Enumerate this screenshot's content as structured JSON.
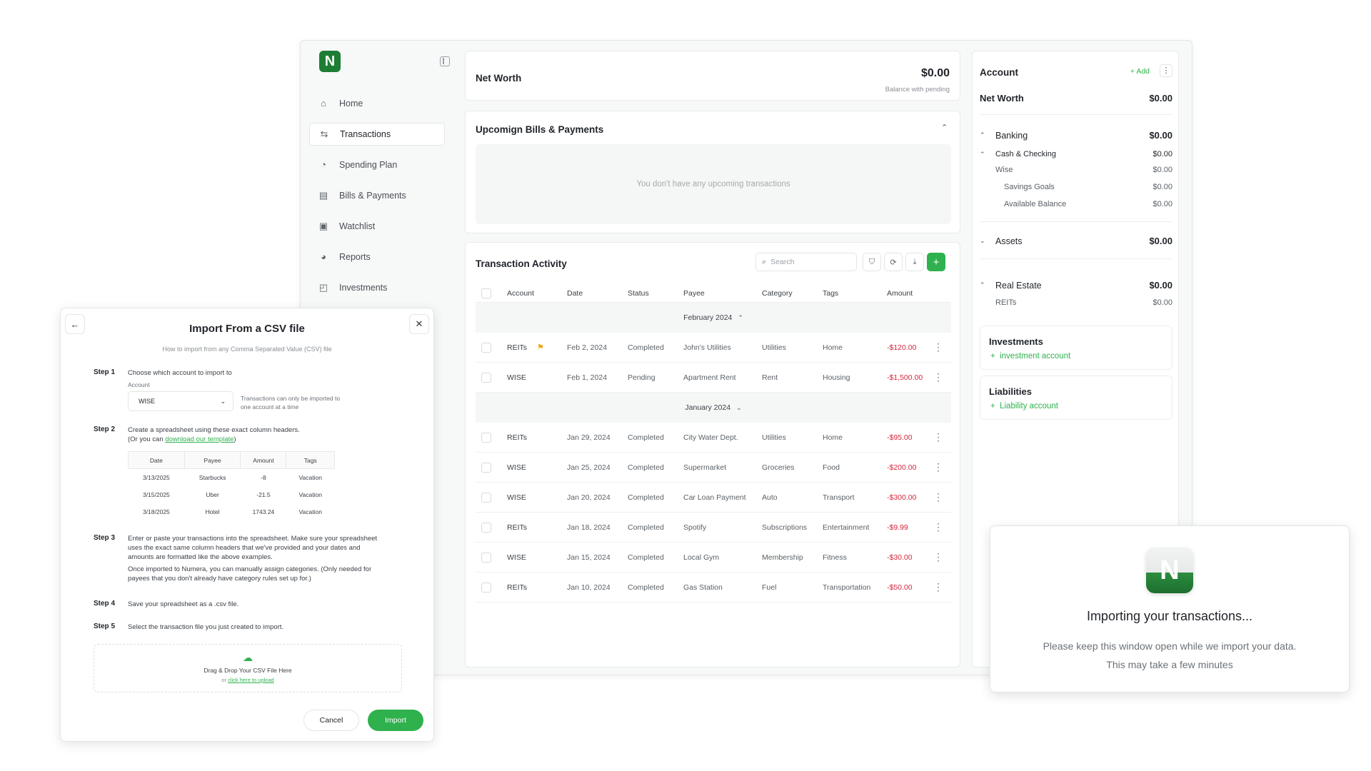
{
  "app": {
    "logo_letter": "N"
  },
  "sidebar": {
    "items": [
      {
        "label": "Home",
        "icon": "home-icon"
      },
      {
        "label": "Transactions",
        "icon": "transfer-icon",
        "active": true
      },
      {
        "label": "Spending Plan",
        "icon": "plan-icon"
      },
      {
        "label": "Bills & Payments",
        "icon": "bill-icon"
      },
      {
        "label": "Watchlist",
        "icon": "watchlist-icon"
      },
      {
        "label": "Reports",
        "icon": "pie-chart-icon"
      },
      {
        "label": "Investments",
        "icon": "investments-icon"
      }
    ]
  },
  "networth": {
    "label": "Net Worth",
    "value": "$0.00",
    "sub": "Balance with pending"
  },
  "bills": {
    "title": "Upcomign Bills & Payments",
    "empty": "You don't have any upcoming transactions"
  },
  "activity": {
    "title": "Transaction Activity",
    "search_placeholder": "Search",
    "columns": [
      "Account",
      "Date",
      "Status",
      "Payee",
      "Category",
      "Tags",
      "Amount"
    ],
    "groups": [
      {
        "label": "February 2024",
        "rows": [
          {
            "account": "REITs",
            "flag": true,
            "date": "Feb 2, 2024",
            "status": "Completed",
            "payee": "John's Utilities",
            "category": "Utilities",
            "tags": "Home",
            "amount": "-$120.00"
          },
          {
            "account": "WISE",
            "flag": false,
            "date": "Feb 1, 2024",
            "status": "Pending",
            "payee": "Apartment Rent",
            "category": "Rent",
            "tags": "Housing",
            "amount": "-$1,500.00"
          }
        ]
      },
      {
        "label": "January 2024",
        "rows": [
          {
            "account": "REITs",
            "date": "Jan 29, 2024",
            "status": "Completed",
            "payee": "City Water Dept.",
            "category": "Utilities",
            "tags": "Home",
            "amount": "-$95.00"
          },
          {
            "account": "WISE",
            "date": "Jan 25, 2024",
            "status": "Completed",
            "payee": "Supermarket",
            "category": "Groceries",
            "tags": "Food",
            "amount": "-$200.00"
          },
          {
            "account": "WISE",
            "date": "Jan 20, 2024",
            "status": "Completed",
            "payee": "Car Loan Payment",
            "category": "Auto",
            "tags": "Transport",
            "amount": "-$300.00"
          },
          {
            "account": "REITs",
            "date": "Jan 18, 2024",
            "status": "Completed",
            "payee": "Spotify",
            "category": "Subscriptions",
            "tags": "Entertainment",
            "amount": "-$9.99"
          },
          {
            "account": "WISE",
            "date": "Jan 15, 2024",
            "status": "Completed",
            "payee": "Local Gym",
            "category": "Membership",
            "tags": "Fitness",
            "amount": "-$30.00"
          },
          {
            "account": "REITs",
            "date": "Jan 10, 2024",
            "status": "Completed",
            "payee": "Gas Station",
            "category": "Fuel",
            "tags": "Transportation",
            "amount": "-$50.00"
          }
        ]
      }
    ]
  },
  "account": {
    "title": "Account",
    "add_label": "Add",
    "net_worth_label": "Net Worth",
    "net_worth_value": "$0.00",
    "banking_label": "Banking",
    "banking_value": "$0.00",
    "cash_label": "Cash & Checking",
    "cash_value": "$0.00",
    "wise_label": "Wise",
    "wise_value": "$0.00",
    "savings_label": "Savings Goals",
    "savings_value": "$0.00",
    "available_label": "Available Balance",
    "available_value": "$0.00",
    "assets_label": "Assets",
    "assets_value": "$0.00",
    "realestate_label": "Real Estate",
    "realestate_value": "$0.00",
    "reits_label": "REITs",
    "reits_value": "$0.00",
    "investments_label": "Investments",
    "investments_link": "investment account",
    "liabilities_label": "Liabilities",
    "liabilities_link": "Liability account"
  },
  "import_dialog": {
    "title": "Import From a CSV file",
    "subtitle": "How to import from any Comma Separated Value (CSV) file",
    "step1_label": "Step 1",
    "step1_text": "Choose which account to import to",
    "account_label": "Account",
    "account_value": "WISE",
    "account_note": "Transactions can only be imported to one account at a time",
    "step2_label": "Step 2",
    "step2_text": "Create a spreadsheet using these exact column headers.",
    "step2_prefix": "(Or you can ",
    "step2_link": "download our template",
    "step2_suffix": ")",
    "sample_headers": [
      "Date",
      "Payee",
      "Amount",
      "Tags"
    ],
    "sample_rows": [
      [
        "3/13/2025",
        "Starbucks",
        "-8",
        "Vacation"
      ],
      [
        "3/15/2025",
        "Uber",
        "-21.5",
        "Vacation"
      ],
      [
        "3/18/2025",
        "Hotel",
        "1743.24",
        "Vacation"
      ]
    ],
    "step3_label": "Step 3",
    "step3_text": "Enter or paste your transactions into the spreadsheet. Make sure your spreadsheet uses the exact same column headers that we've provided and your dates and amounts are formatted like the above examples.",
    "step3_text2": "Once imported to Numera, you can manually assign categories. (Only needed for payees that you don't already have category rules set up for.)",
    "step4_label": "Step 4",
    "step4_text": "Save your spreadsheet as a .csv file.",
    "step5_label": "Step 5",
    "step5_text": "Select the transaction file you just created to import.",
    "drop_text": "Drag & Drop Your CSV File Here",
    "drop_or": "or ",
    "drop_link": "click here to upload",
    "cancel_label": "Cancel",
    "import_label": "Import"
  },
  "importing": {
    "title": "Importing your transactions...",
    "line1": "Please keep this window open while we import your data.",
    "line2": "This may take a few minutes"
  },
  "colors": {
    "brand": "#1d7d34",
    "accent": "#2fb14e",
    "negative": "#d7263d",
    "flag": "#f2a30f"
  }
}
